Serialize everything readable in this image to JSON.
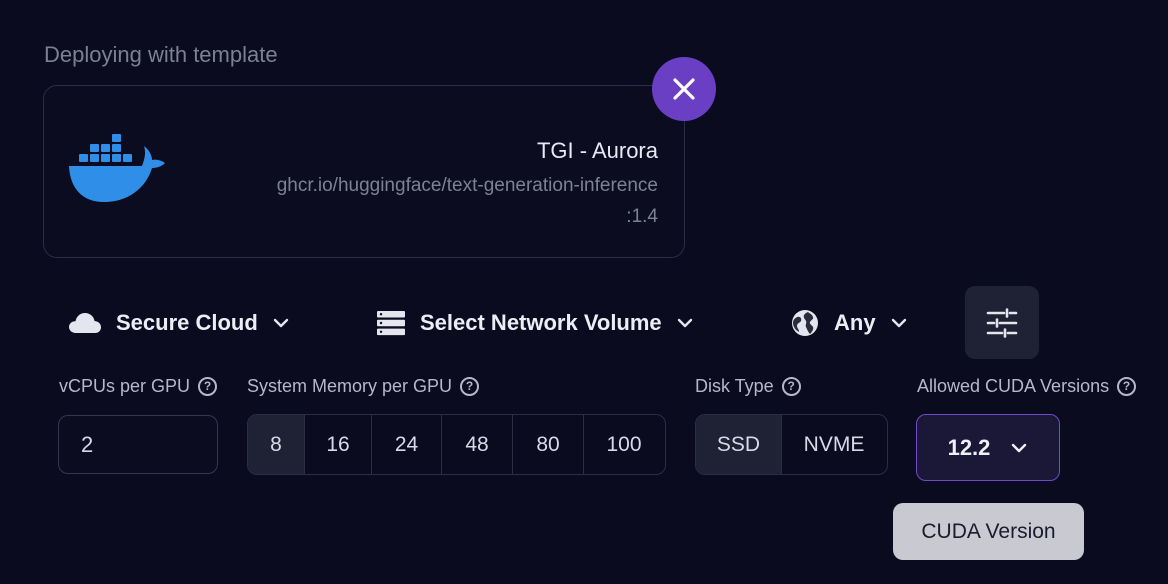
{
  "template": {
    "section_label": "Deploying with template",
    "name": "TGI - Aurora",
    "image_path": "ghcr.io/huggingface/text-generation-inference",
    "image_tag": ":1.4"
  },
  "selectors": {
    "cloud": {
      "label": "Secure Cloud",
      "icon": "cloud-icon"
    },
    "network_volume": {
      "label": "Select Network Volume",
      "icon": "server-icon"
    },
    "region": {
      "label": "Any",
      "icon": "globe-icon"
    },
    "filter_icon": "sliders-icon"
  },
  "fields": {
    "vcpus": {
      "label": "vCPUs per GPU",
      "value": "2"
    },
    "memory": {
      "label": "System Memory per GPU",
      "options": [
        "8",
        "16",
        "24",
        "48",
        "80",
        "100"
      ],
      "selected": "8"
    },
    "disk": {
      "label": "Disk Type",
      "options": [
        "SSD",
        "NVME"
      ],
      "selected": "SSD"
    },
    "cuda": {
      "label": "Allowed CUDA Versions",
      "value": "12.2",
      "tooltip": "CUDA Version"
    }
  },
  "colors": {
    "background": "#0a0b1e",
    "accent_purple": "#6b3fc4",
    "docker_blue": "#2f8fe8"
  }
}
